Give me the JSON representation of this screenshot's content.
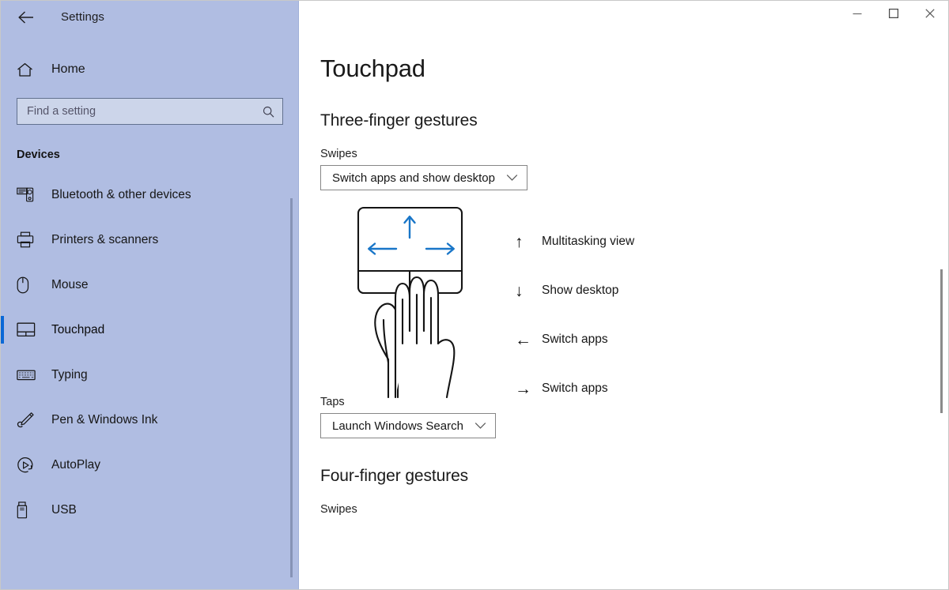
{
  "titlebar": {
    "app_title": "Settings",
    "back_icon": "back-arrow-icon",
    "minimize_label": "Minimize",
    "maximize_label": "Maximize",
    "close_label": "Close"
  },
  "sidebar": {
    "home_label": "Home",
    "home_icon": "home-icon",
    "search": {
      "placeholder": "Find a setting",
      "value": "",
      "icon": "search-icon"
    },
    "group_header": "Devices",
    "items": [
      {
        "label": "Bluetooth & other devices",
        "icon": "bluetooth-devices-icon",
        "selected": false
      },
      {
        "label": "Printers & scanners",
        "icon": "printer-icon",
        "selected": false
      },
      {
        "label": "Mouse",
        "icon": "mouse-icon",
        "selected": false
      },
      {
        "label": "Touchpad",
        "icon": "touchpad-icon",
        "selected": true
      },
      {
        "label": "Typing",
        "icon": "keyboard-icon",
        "selected": false
      },
      {
        "label": "Pen & Windows Ink",
        "icon": "pen-icon",
        "selected": false
      },
      {
        "label": "AutoPlay",
        "icon": "autoplay-icon",
        "selected": false
      },
      {
        "label": "USB",
        "icon": "usb-icon",
        "selected": false
      }
    ]
  },
  "main": {
    "page_title": "Touchpad",
    "three_finger": {
      "section_title": "Three-finger gestures",
      "swipes_label": "Swipes",
      "swipes_value": "Switch apps and show desktop",
      "figure": {
        "name": "three-finger-swipe-illustration",
        "arrow_color": "#1976c8",
        "arrows": [
          "up",
          "left",
          "right"
        ]
      },
      "legend": [
        {
          "arrow": "↑",
          "direction": "up",
          "text": "Multitasking view"
        },
        {
          "arrow": "↓",
          "direction": "down",
          "text": "Show desktop"
        },
        {
          "arrow": "←",
          "direction": "left",
          "text": "Switch apps"
        },
        {
          "arrow": "→",
          "direction": "right",
          "text": "Switch apps"
        }
      ],
      "taps_label": "Taps",
      "taps_value": "Launch Windows Search"
    },
    "four_finger": {
      "section_title": "Four-finger gestures",
      "swipes_label": "Swipes"
    }
  },
  "colors": {
    "sidebar_bg": "#b0bde2",
    "accent": "#0a68d6",
    "main_bg": "#ffffff",
    "text": "#1a1a1a",
    "arrow_blue": "#1976c8"
  }
}
